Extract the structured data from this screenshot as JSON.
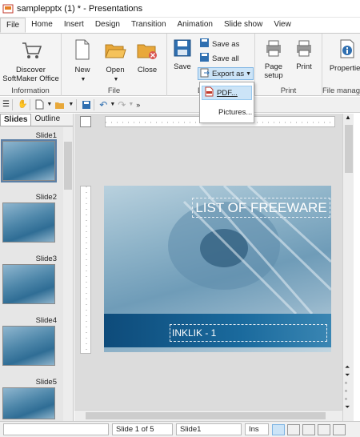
{
  "window": {
    "title": "samplepptx (1) * - Presentations"
  },
  "menu": {
    "tabs": [
      "File",
      "Home",
      "Insert",
      "Design",
      "Transition",
      "Animation",
      "Slide show",
      "View"
    ]
  },
  "ribbon": {
    "information": {
      "discover_label": "Discover",
      "discover_label2": "SoftMaker Office",
      "group_label": "Information"
    },
    "file": {
      "new_label": "New",
      "open_label": "Open",
      "close_label": "Close",
      "group_label": "File"
    },
    "save": {
      "save_label": "Save",
      "save_as_label": "Save as",
      "save_all_label": "Save all",
      "export_as_label": "Export as",
      "group_label": "D"
    },
    "print": {
      "page_setup_label": "Page",
      "page_setup_label2": "setup",
      "print_label": "Print",
      "group_label": "Print"
    },
    "properties": {
      "label": "Properties",
      "group_label": "File manag"
    }
  },
  "export_menu": {
    "items": [
      "PDF...",
      "Pictures..."
    ]
  },
  "left_panel": {
    "tabs": [
      "Slides",
      "Outline"
    ],
    "slides": [
      {
        "label": "Slide1"
      },
      {
        "label": "Slide2"
      },
      {
        "label": "Slide3"
      },
      {
        "label": "Slide4"
      },
      {
        "label": "Slide5"
      }
    ]
  },
  "slide": {
    "title": "LIST OF FREEWARE",
    "subtitle": "INKLIK - 1"
  },
  "status": {
    "page_info": "Slide 1 of 5",
    "slide_name": "Slide1",
    "insert_mode": "Ins"
  },
  "colors": {
    "accent": "#1a6a9d",
    "ribbon_bg": "#f4f4f4",
    "highlight": "#cce4f7"
  }
}
